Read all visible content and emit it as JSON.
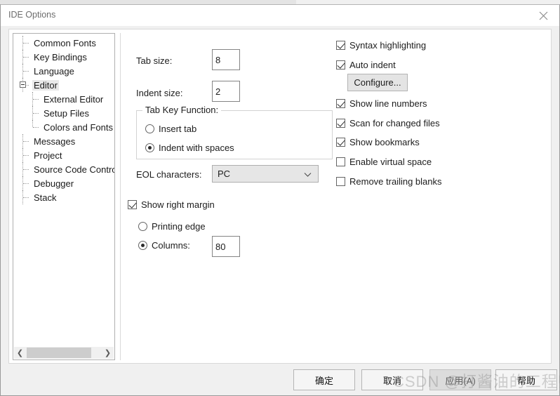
{
  "window": {
    "title": "IDE Options",
    "close_icon": "close-icon"
  },
  "tree": {
    "items": [
      {
        "label": "Common Fonts",
        "level": 0,
        "selected": false,
        "expander": false
      },
      {
        "label": "Key Bindings",
        "level": 0,
        "selected": false,
        "expander": false
      },
      {
        "label": "Language",
        "level": 0,
        "selected": false,
        "expander": false
      },
      {
        "label": "Editor",
        "level": 0,
        "selected": true,
        "expander": true
      },
      {
        "label": "External Editor",
        "level": 1,
        "selected": false,
        "expander": false
      },
      {
        "label": "Setup Files",
        "level": 1,
        "selected": false,
        "expander": false
      },
      {
        "label": "Colors and Fonts",
        "level": 1,
        "selected": false,
        "expander": false
      },
      {
        "label": "Messages",
        "level": 0,
        "selected": false,
        "expander": false
      },
      {
        "label": "Project",
        "level": 0,
        "selected": false,
        "expander": false
      },
      {
        "label": "Source Code Contro",
        "level": 0,
        "selected": false,
        "expander": false
      },
      {
        "label": "Debugger",
        "level": 0,
        "selected": false,
        "expander": false
      },
      {
        "label": "Stack",
        "level": 0,
        "selected": false,
        "expander": false
      }
    ],
    "scrollbar": {
      "left_arrow": "❮",
      "right_arrow": "❯"
    }
  },
  "editor_options": {
    "tab_size": {
      "label": "Tab size:",
      "value": "8"
    },
    "indent_size": {
      "label": "Indent size:",
      "value": "2"
    },
    "tab_key_function": {
      "legend": "Tab Key Function:",
      "options": [
        {
          "label": "Insert tab",
          "selected": false
        },
        {
          "label": "Indent with spaces",
          "selected": true
        }
      ]
    },
    "eol_characters": {
      "label": "EOL characters:",
      "value": "PC",
      "chevron_icon": "chevron-down-icon"
    },
    "show_right_margin": {
      "label": "Show right margin",
      "checked": true
    },
    "margin_mode": {
      "options": [
        {
          "label": "Printing edge",
          "selected": false
        },
        {
          "label": "Columns:",
          "selected": true
        }
      ],
      "columns_value": "80"
    },
    "checkboxes": [
      {
        "label": "Syntax highlighting",
        "checked": true
      },
      {
        "label": "Auto indent",
        "checked": true
      },
      {
        "label": "Show line numbers",
        "checked": true
      },
      {
        "label": "Scan for changed files",
        "checked": true
      },
      {
        "label": "Show bookmarks",
        "checked": true
      },
      {
        "label": "Enable virtual space",
        "checked": false
      },
      {
        "label": "Remove trailing blanks",
        "checked": false
      }
    ],
    "configure_button": "Configure..."
  },
  "buttons": {
    "ok": "确定",
    "cancel": "取消",
    "apply": "应用(A)",
    "help": "帮助"
  },
  "watermark": "CSDN @打酱油的工程师",
  "background_glyphs": "C\nA\na",
  "colors": {
    "dialog_bg": "#f0f0f0",
    "panel_bg": "#ffffff",
    "title_text": "#6d6d6d",
    "text": "#1c1c1c",
    "button_face": "#f5f5f5",
    "disabled_face": "#dcdcdc",
    "selection": "#e8e8e8"
  }
}
